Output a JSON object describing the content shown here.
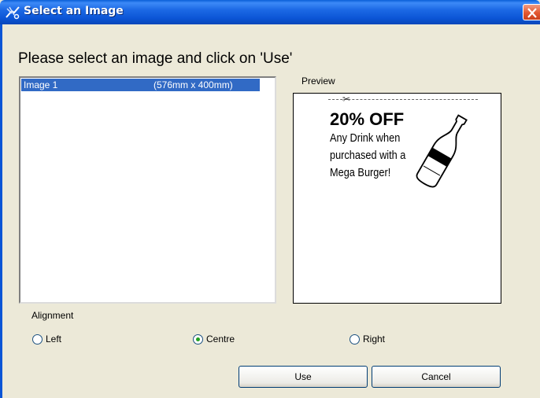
{
  "window": {
    "title": "Select an Image"
  },
  "heading": "Please select an image and click on 'Use'",
  "image_list": {
    "items": [
      {
        "name": "Image 1",
        "size": "(576mm x 400mm)",
        "selected": true
      }
    ]
  },
  "preview": {
    "label": "Preview",
    "headline": "20% OFF",
    "lines": [
      "Any Drink when",
      "purchased with a",
      "Mega Burger!"
    ]
  },
  "alignment": {
    "label": "Alignment",
    "options": [
      "Left",
      "Centre",
      "Right"
    ],
    "selected": "Centre"
  },
  "buttons": {
    "use": "Use",
    "cancel": "Cancel"
  },
  "colors": {
    "selection": "#316ac5",
    "titlebar": "#0b55d6",
    "face": "#ece9d8"
  }
}
